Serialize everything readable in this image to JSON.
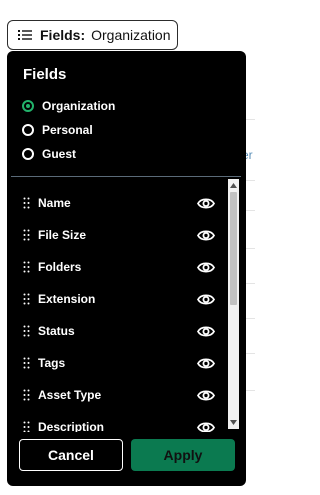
{
  "fields_button": {
    "label": "Fields:",
    "value": "Organization"
  },
  "panel": {
    "title": "Fields",
    "scope_options": [
      {
        "label": "Organization",
        "checked": true
      },
      {
        "label": "Personal",
        "checked": false
      },
      {
        "label": "Guest",
        "checked": false
      }
    ],
    "fields": [
      {
        "label": "Name",
        "visible": true
      },
      {
        "label": "File Size",
        "visible": true
      },
      {
        "label": "Folders",
        "visible": true
      },
      {
        "label": "Extension",
        "visible": true
      },
      {
        "label": "Status",
        "visible": true
      },
      {
        "label": "Tags",
        "visible": true
      },
      {
        "label": "Asset Type",
        "visible": true
      },
      {
        "label": "Description",
        "visible": true
      }
    ],
    "cancel_label": "Cancel",
    "apply_label": "Apply"
  },
  "background": {
    "partial_text": "er"
  },
  "colors": {
    "accent_green": "#22b36b",
    "apply_bg": "#0b7a50"
  }
}
